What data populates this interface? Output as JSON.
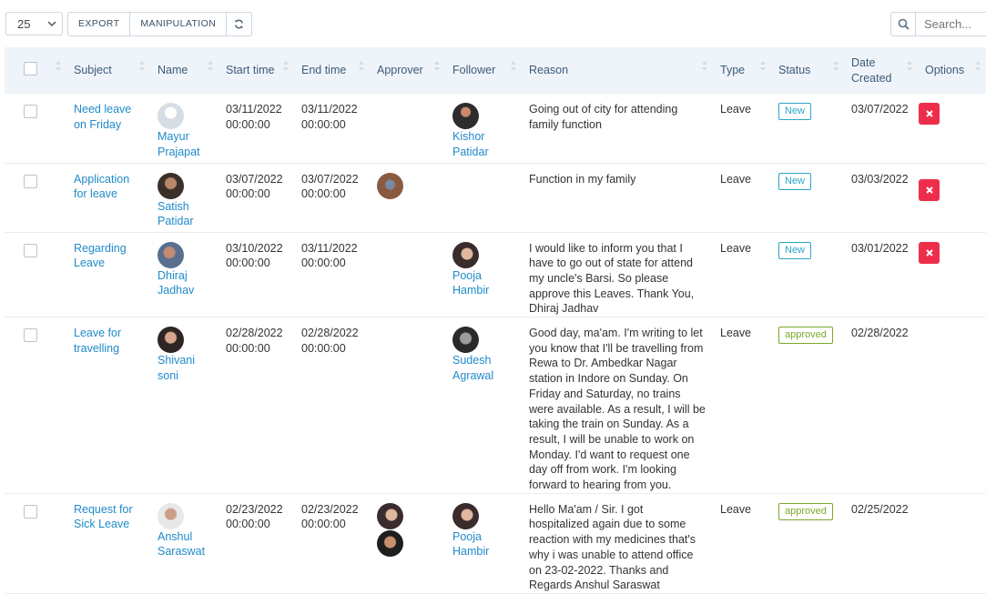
{
  "toolbar": {
    "page_size": "25",
    "buttons": [
      "EXPORT",
      "MANIPULATION"
    ],
    "refresh_icon": "refresh-icon",
    "search_placeholder": "Search..."
  },
  "table": {
    "headers": {
      "subject": "Subject",
      "name": "Name",
      "start_time": "Start time",
      "end_time": "End time",
      "approver": "Approver",
      "follower": "Follower",
      "reason": "Reason",
      "type": "Type",
      "status": "Status",
      "date_created": "Date Created",
      "options": "Options"
    },
    "rows": [
      {
        "subject": "Need leave on Friday",
        "name": "Mayur Prajapat",
        "start": "03/11/2022 00:00:00",
        "end": "03/11/2022 00:00:00",
        "follower": "Kishor Patidar",
        "reason": "Going out of city for attending family function",
        "type": "Leave",
        "status": "New",
        "date_created": "03/07/2022"
      },
      {
        "subject": "Application for leave",
        "name": "Satish Patidar",
        "start": "03/07/2022 00:00:00",
        "end": "03/07/2022 00:00:00",
        "follower": "",
        "reason": "Function in my family",
        "type": "Leave",
        "status": "New",
        "date_created": "03/03/2022"
      },
      {
        "subject": "Regarding Leave",
        "name": "Dhiraj Jadhav",
        "start": "03/10/2022 00:00:00",
        "end": "03/11/2022 00:00:00",
        "follower": "Pooja Hambir",
        "reason": "I would like to inform you that I have to go out of state for attend my uncle's Barsi. So please approve this Leaves. Thank You, Dhiraj Jadhav",
        "type": "Leave",
        "status": "New",
        "date_created": "03/01/2022"
      },
      {
        "subject": "Leave for travelling",
        "name": "Shivani soni",
        "start": "02/28/2022 00:00:00",
        "end": "02/28/2022 00:00:00",
        "follower": "Sudesh Agrawal",
        "reason": "Good day, ma'am. I'm writing to let you know that I'll be travelling from Rewa to Dr. Ambedkar Nagar station in Indore on Sunday. On Friday and Saturday, no trains were available. As a result, I will be taking the train on Sunday. As a result, I will be unable to work on Monday. I'd want to request one day off from work. I'm looking forward to hearing from you.",
        "type": "Leave",
        "status": "approved",
        "date_created": "02/28/2022"
      },
      {
        "subject": "Request for Sick Leave",
        "name": "Anshul Saraswat",
        "start": "02/23/2022 00:00:00",
        "end": "02/23/2022 00:00:00",
        "follower": "Pooja Hambir",
        "reason": "Hello Ma'am / Sir. I got hospitalized again due to some reaction with my medicines that's why i was unable to attend office on 23-02-2022. Thanks and Regards Anshul Saraswat",
        "type": "Leave",
        "status": "approved",
        "date_created": "02/25/2022"
      }
    ]
  },
  "colors": {
    "link": "#1f8ac9",
    "header_bg": "#eef4f9",
    "new_badge": "#2ba6c8",
    "approved_badge": "#7ba82a",
    "delete_button": "#ed2e4b"
  }
}
